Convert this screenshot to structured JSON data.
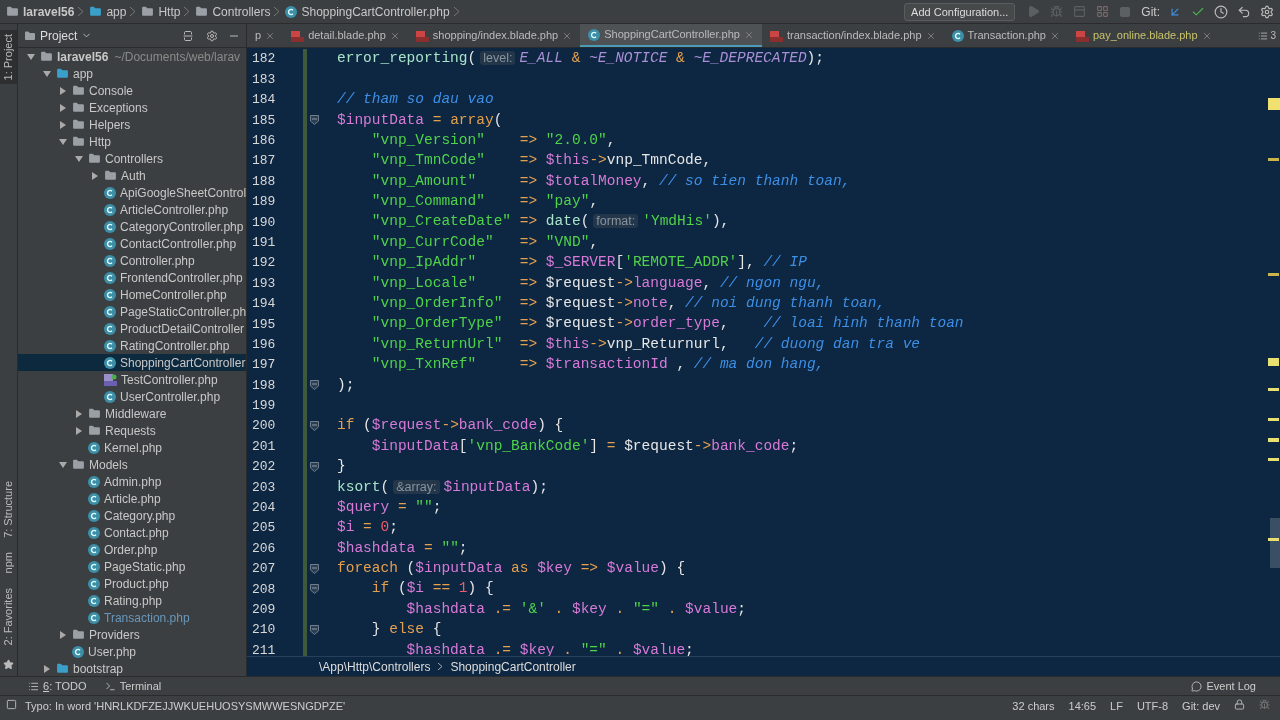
{
  "navbar": {
    "breadcrumb": [
      {
        "kind": "folder",
        "text": "laravel56"
      },
      {
        "kind": "folder",
        "text": "app"
      },
      {
        "kind": "folder",
        "text": "Http"
      },
      {
        "kind": "folder",
        "text": "Controllers"
      },
      {
        "kind": "class",
        "text": "ShoppingCartController.php"
      }
    ],
    "config_button": "Add Configuration...",
    "git_label": "Git:"
  },
  "tool_strip": {
    "top": "1: Project",
    "bottom": [
      "7: Structure",
      "npm",
      "2: Favorites"
    ]
  },
  "project": {
    "title": "Project",
    "tree": [
      {
        "name": "laravel56",
        "note": "~/Documents/web/larav",
        "kind": "folder",
        "expanded": true,
        "selected": false,
        "children": [
          {
            "name": "app",
            "kind": "folder",
            "expanded": true,
            "selected": false,
            "children": [
              {
                "name": "Console",
                "kind": "folder",
                "expanded": false,
                "selected": false
              },
              {
                "name": "Exceptions",
                "kind": "folder",
                "expanded": false,
                "selected": false
              },
              {
                "name": "Helpers",
                "kind": "folder",
                "expanded": false,
                "selected": false
              },
              {
                "name": "Http",
                "kind": "folder",
                "expanded": true,
                "selected": false,
                "children": [
                  {
                    "name": "Controllers",
                    "kind": "folder",
                    "expanded": true,
                    "selected": false,
                    "children": [
                      {
                        "name": "Auth",
                        "kind": "folder",
                        "expanded": false,
                        "selected": false
                      },
                      {
                        "name": "ApiGoogleSheetControl",
                        "kind": "class",
                        "changed": false,
                        "selected": false
                      },
                      {
                        "name": "ArticleController.php",
                        "kind": "class",
                        "changed": false,
                        "selected": false
                      },
                      {
                        "name": "CategoryController.php",
                        "kind": "class",
                        "changed": false,
                        "selected": false
                      },
                      {
                        "name": "ContactController.php",
                        "kind": "class",
                        "changed": false,
                        "selected": false
                      },
                      {
                        "name": "Controller.php",
                        "kind": "class",
                        "changed": false,
                        "selected": false
                      },
                      {
                        "name": "FrontendController.php",
                        "kind": "class",
                        "changed": false,
                        "selected": false
                      },
                      {
                        "name": "HomeController.php",
                        "kind": "class",
                        "changed": false,
                        "selected": false
                      },
                      {
                        "name": "PageStaticController.ph",
                        "kind": "class",
                        "changed": false,
                        "selected": false
                      },
                      {
                        "name": "ProductDetailController",
                        "kind": "class",
                        "changed": false,
                        "selected": false
                      },
                      {
                        "name": "RatingController.php",
                        "kind": "class",
                        "changed": false,
                        "selected": false
                      },
                      {
                        "name": "ShoppingCartController",
                        "kind": "class",
                        "changed": false,
                        "selected": true
                      },
                      {
                        "name": "TestController.php",
                        "kind": "php",
                        "changed": false,
                        "selected": false
                      },
                      {
                        "name": "UserController.php",
                        "kind": "class",
                        "changed": false,
                        "selected": false
                      }
                    ]
                  },
                  {
                    "name": "Middleware",
                    "kind": "folder",
                    "expanded": false,
                    "selected": false
                  },
                  {
                    "name": "Requests",
                    "kind": "folder",
                    "expanded": false,
                    "selected": false
                  },
                  {
                    "name": "Kernel.php",
                    "kind": "class",
                    "changed": false,
                    "selected": false
                  }
                ]
              },
              {
                "name": "Models",
                "kind": "folder",
                "expanded": true,
                "selected": false,
                "children": [
                  {
                    "name": "Admin.php",
                    "kind": "class",
                    "changed": false,
                    "selected": false
                  },
                  {
                    "name": "Article.php",
                    "kind": "class",
                    "changed": false,
                    "selected": false
                  },
                  {
                    "name": "Category.php",
                    "kind": "class",
                    "changed": false,
                    "selected": false
                  },
                  {
                    "name": "Contact.php",
                    "kind": "class",
                    "changed": false,
                    "selected": false
                  },
                  {
                    "name": "Order.php",
                    "kind": "class",
                    "changed": false,
                    "selected": false
                  },
                  {
                    "name": "PageStatic.php",
                    "kind": "class",
                    "changed": false,
                    "selected": false
                  },
                  {
                    "name": "Product.php",
                    "kind": "class",
                    "changed": false,
                    "selected": false
                  },
                  {
                    "name": "Rating.php",
                    "kind": "class",
                    "changed": false,
                    "selected": false
                  },
                  {
                    "name": "Transaction.php",
                    "kind": "class",
                    "changed": true,
                    "selected": false
                  }
                ]
              },
              {
                "name": "Providers",
                "kind": "folder",
                "expanded": false,
                "selected": false
              },
              {
                "name": "User.php",
                "kind": "class",
                "changed": false,
                "selected": false
              }
            ]
          },
          {
            "name": "bootstrap",
            "kind": "folder",
            "expanded": false,
            "selected": false
          }
        ]
      }
    ]
  },
  "tabs": [
    {
      "label": "p",
      "kind": "none",
      "selected": false,
      "modified": false
    },
    {
      "label": "detail.blade.php",
      "kind": "blade",
      "selected": false,
      "modified": false
    },
    {
      "label": "shopping/index.blade.php",
      "kind": "blade",
      "selected": false,
      "modified": false
    },
    {
      "label": "ShoppingCartController.php",
      "kind": "class",
      "selected": true,
      "modified": false
    },
    {
      "label": "transaction/index.blade.php",
      "kind": "blade",
      "selected": false,
      "modified": false
    },
    {
      "label": "Transaction.php",
      "kind": "class",
      "selected": false,
      "modified": false
    },
    {
      "label": "pay_online.blade.php",
      "kind": "blade",
      "selected": false,
      "modified": true
    }
  ],
  "tab_count": "3",
  "code": [
    {
      "number": "182",
      "fold": false,
      "tokens": [
        {
          "kind": "function",
          "text": "error_reporting"
        },
        {
          "kind": "plain",
          "text": "("
        },
        {
          "kind": "hint",
          "text": "level:"
        },
        {
          "kind": "constant",
          "text": "E_ALL"
        },
        {
          "kind": "operator",
          "text": " & "
        },
        {
          "kind": "constant",
          "text": "~E_NOTICE"
        },
        {
          "kind": "operator",
          "text": " & "
        },
        {
          "kind": "constant",
          "text": "~E_DEPRECATED"
        },
        {
          "kind": "plain",
          "text": ");"
        }
      ]
    },
    {
      "number": "183",
      "fold": false
    },
    {
      "number": "184",
      "fold": false,
      "tokens": [
        {
          "kind": "comment",
          "text": "// tham so dau vao"
        }
      ]
    },
    {
      "number": "185",
      "fold": true,
      "tokens": [
        {
          "kind": "variable",
          "text": "$inputData"
        },
        {
          "kind": "operator",
          "text": " = "
        },
        {
          "kind": "keyword",
          "text": "array"
        },
        {
          "kind": "plain",
          "text": "("
        }
      ]
    },
    {
      "number": "186",
      "fold": false,
      "tokens": [
        {
          "kind": "string",
          "text": "    \"vnp_Version\""
        },
        {
          "kind": "operator",
          "text": "    => "
        },
        {
          "kind": "string",
          "text": "\"2.0.0\""
        },
        {
          "kind": "plain",
          "text": ","
        }
      ]
    },
    {
      "number": "187",
      "fold": false,
      "tokens": [
        {
          "kind": "string",
          "text": "    \"vnp_TmnCode\""
        },
        {
          "kind": "operator",
          "text": "    => "
        },
        {
          "kind": "variable",
          "text": "$this"
        },
        {
          "kind": "operator",
          "text": "->"
        },
        {
          "kind": "plain",
          "text": "vnp_TmnCode,"
        }
      ]
    },
    {
      "number": "188",
      "fold": false,
      "tokens": [
        {
          "kind": "string",
          "text": "    \"vnp_Amount\""
        },
        {
          "kind": "operator",
          "text": "     => "
        },
        {
          "kind": "variable",
          "text": "$totalMoney"
        },
        {
          "kind": "plain",
          "text": ", "
        },
        {
          "kind": "comment",
          "text": "// so tien thanh toan,"
        }
      ]
    },
    {
      "number": "189",
      "fold": false,
      "tokens": [
        {
          "kind": "string",
          "text": "    \"vnp_Command\""
        },
        {
          "kind": "operator",
          "text": "    => "
        },
        {
          "kind": "string",
          "text": "\"pay\""
        },
        {
          "kind": "plain",
          "text": ","
        }
      ]
    },
    {
      "number": "190",
      "fold": false,
      "tokens": [
        {
          "kind": "string",
          "text": "    \"vnp_CreateDate\""
        },
        {
          "kind": "operator",
          "text": " => "
        },
        {
          "kind": "function",
          "text": "date"
        },
        {
          "kind": "plain",
          "text": "("
        },
        {
          "kind": "hint",
          "text": "format:"
        },
        {
          "kind": "string",
          "text": "'YmdHis'"
        },
        {
          "kind": "plain",
          "text": "),"
        }
      ]
    },
    {
      "number": "191",
      "fold": false,
      "tokens": [
        {
          "kind": "string",
          "text": "    \"vnp_CurrCode\""
        },
        {
          "kind": "operator",
          "text": "   => "
        },
        {
          "kind": "string",
          "text": "\"VND\""
        },
        {
          "kind": "plain",
          "text": ","
        }
      ]
    },
    {
      "number": "192",
      "fold": false,
      "tokens": [
        {
          "kind": "string",
          "text": "    \"vnp_IpAddr\""
        },
        {
          "kind": "operator",
          "text": "     => "
        },
        {
          "kind": "variable",
          "text": "$_SERVER"
        },
        {
          "kind": "plain",
          "text": "["
        },
        {
          "kind": "string",
          "text": "'REMOTE_ADDR'"
        },
        {
          "kind": "plain",
          "text": "], "
        },
        {
          "kind": "comment",
          "text": "// IP"
        }
      ]
    },
    {
      "number": "193",
      "fold": false,
      "tokens": [
        {
          "kind": "string",
          "text": "    \"vnp_Locale\""
        },
        {
          "kind": "operator",
          "text": "     => "
        },
        {
          "kind": "plain",
          "text": "$request"
        },
        {
          "kind": "operator",
          "text": "->"
        },
        {
          "kind": "property",
          "text": "language"
        },
        {
          "kind": "plain",
          "text": ", "
        },
        {
          "kind": "comment",
          "text": "// ngon ngu,"
        }
      ]
    },
    {
      "number": "194",
      "fold": false,
      "tokens": [
        {
          "kind": "string",
          "text": "    \"vnp_OrderInfo\""
        },
        {
          "kind": "operator",
          "text": "  => "
        },
        {
          "kind": "plain",
          "text": "$request"
        },
        {
          "kind": "operator",
          "text": "->"
        },
        {
          "kind": "property",
          "text": "note"
        },
        {
          "kind": "plain",
          "text": ", "
        },
        {
          "kind": "comment",
          "text": "// noi dung thanh toan,"
        }
      ]
    },
    {
      "number": "195",
      "fold": false,
      "tokens": [
        {
          "kind": "string",
          "text": "    \"vnp_OrderType\""
        },
        {
          "kind": "operator",
          "text": "  => "
        },
        {
          "kind": "plain",
          "text": "$request"
        },
        {
          "kind": "operator",
          "text": "->"
        },
        {
          "kind": "property",
          "text": "order_type"
        },
        {
          "kind": "plain",
          "text": ",    "
        },
        {
          "kind": "comment",
          "text": "// loai hinh thanh toan"
        }
      ]
    },
    {
      "number": "196",
      "fold": false,
      "tokens": [
        {
          "kind": "string",
          "text": "    \"vnp_ReturnUrl\""
        },
        {
          "kind": "operator",
          "text": "  => "
        },
        {
          "kind": "variable",
          "text": "$this"
        },
        {
          "kind": "operator",
          "text": "->"
        },
        {
          "kind": "plain",
          "text": "vnp_Returnurl,   "
        },
        {
          "kind": "comment",
          "text": "// duong dan tra ve"
        }
      ]
    },
    {
      "number": "197",
      "fold": false,
      "tokens": [
        {
          "kind": "string",
          "text": "    \"vnp_TxnRef\""
        },
        {
          "kind": "operator",
          "text": "     => "
        },
        {
          "kind": "variable",
          "text": "$transactionId"
        },
        {
          "kind": "plain",
          "text": " , "
        },
        {
          "kind": "comment",
          "text": "// ma don hang,"
        }
      ]
    },
    {
      "number": "198",
      "fold": true,
      "tokens": [
        {
          "kind": "plain",
          "text": ");"
        }
      ]
    },
    {
      "number": "199",
      "fold": false
    },
    {
      "number": "200",
      "fold": true,
      "tokens": [
        {
          "kind": "keyword",
          "text": "if"
        },
        {
          "kind": "plain",
          "text": " ("
        },
        {
          "kind": "variable",
          "text": "$request"
        },
        {
          "kind": "operator",
          "text": "->"
        },
        {
          "kind": "property",
          "text": "bank_code"
        },
        {
          "kind": "plain",
          "text": ") {"
        }
      ]
    },
    {
      "number": "201",
      "fold": false,
      "tokens": [
        {
          "kind": "variable",
          "text": "    $inputData"
        },
        {
          "kind": "plain",
          "text": "["
        },
        {
          "kind": "string",
          "text": "'vnp_BankCode'"
        },
        {
          "kind": "plain",
          "text": "] "
        },
        {
          "kind": "operator",
          "text": "= "
        },
        {
          "kind": "plain",
          "text": "$request"
        },
        {
          "kind": "operator",
          "text": "->"
        },
        {
          "kind": "property",
          "text": "bank_code"
        },
        {
          "kind": "plain",
          "text": ";"
        }
      ]
    },
    {
      "number": "202",
      "fold": true,
      "tokens": [
        {
          "kind": "plain",
          "text": "}"
        }
      ]
    },
    {
      "number": "203",
      "fold": false,
      "tokens": [
        {
          "kind": "function",
          "text": "ksort"
        },
        {
          "kind": "plain",
          "text": "("
        },
        {
          "kind": "hint",
          "text": "&array:"
        },
        {
          "kind": "variable",
          "text": "$inputData"
        },
        {
          "kind": "plain",
          "text": ");"
        }
      ]
    },
    {
      "number": "204",
      "fold": false,
      "tokens": [
        {
          "kind": "variable",
          "text": "$query"
        },
        {
          "kind": "operator",
          "text": " = "
        },
        {
          "kind": "string",
          "text": "\"\""
        },
        {
          "kind": "plain",
          "text": ";"
        }
      ]
    },
    {
      "number": "205",
      "fold": false,
      "tokens": [
        {
          "kind": "variable",
          "text": "$i"
        },
        {
          "kind": "operator",
          "text": " = "
        },
        {
          "kind": "number",
          "text": "0"
        },
        {
          "kind": "plain",
          "text": ";"
        }
      ]
    },
    {
      "number": "206",
      "fold": false,
      "tokens": [
        {
          "kind": "variable",
          "text": "$hashdata"
        },
        {
          "kind": "operator",
          "text": " = "
        },
        {
          "kind": "string",
          "text": "\"\""
        },
        {
          "kind": "plain",
          "text": ";"
        }
      ]
    },
    {
      "number": "207",
      "fold": true,
      "tokens": [
        {
          "kind": "keyword",
          "text": "foreach"
        },
        {
          "kind": "plain",
          "text": " ("
        },
        {
          "kind": "variable",
          "text": "$inputData"
        },
        {
          "kind": "keyword",
          "text": " as "
        },
        {
          "kind": "variable",
          "text": "$key"
        },
        {
          "kind": "operator",
          "text": " => "
        },
        {
          "kind": "variable",
          "text": "$value"
        },
        {
          "kind": "plain",
          "text": ") {"
        }
      ]
    },
    {
      "number": "208",
      "fold": true,
      "tokens": [
        {
          "kind": "keyword",
          "text": "    if"
        },
        {
          "kind": "plain",
          "text": " ("
        },
        {
          "kind": "variable",
          "text": "$i"
        },
        {
          "kind": "operator",
          "text": " == "
        },
        {
          "kind": "number",
          "text": "1"
        },
        {
          "kind": "plain",
          "text": ") {"
        }
      ]
    },
    {
      "number": "209",
      "fold": false,
      "tokens": [
        {
          "kind": "variable",
          "text": "        $hashdata"
        },
        {
          "kind": "operator",
          "text": " .= "
        },
        {
          "kind": "string",
          "text": "'&'"
        },
        {
          "kind": "operator",
          "text": " . "
        },
        {
          "kind": "variable",
          "text": "$key"
        },
        {
          "kind": "operator",
          "text": " . "
        },
        {
          "kind": "string",
          "text": "\"=\""
        },
        {
          "kind": "operator",
          "text": " . "
        },
        {
          "kind": "variable",
          "text": "$value"
        },
        {
          "kind": "plain",
          "text": ";"
        }
      ]
    },
    {
      "number": "210",
      "fold": true,
      "tokens": [
        {
          "kind": "plain",
          "text": "    } "
        },
        {
          "kind": "keyword",
          "text": "else"
        },
        {
          "kind": "plain",
          "text": " {"
        }
      ]
    },
    {
      "number": "211",
      "fold": false,
      "tokens": [
        {
          "kind": "variable",
          "text": "        $hashdata"
        },
        {
          "kind": "operator",
          "text": " .= "
        },
        {
          "kind": "variable",
          "text": "$key"
        },
        {
          "kind": "operator",
          "text": " . "
        },
        {
          "kind": "string",
          "text": "\"=\""
        },
        {
          "kind": "operator",
          "text": " . "
        },
        {
          "kind": "variable",
          "text": "$value"
        },
        {
          "kind": "plain",
          "text": ";"
        }
      ]
    }
  ],
  "editor_breadcrumb": [
    "\\App\\Http\\Controllers",
    "ShoppingCartController"
  ],
  "tool_windows": {
    "todo": {
      "key": "6",
      "label": ": TODO"
    },
    "terminal": "Terminal",
    "event_log": "Event Log"
  },
  "status_bar": {
    "message": "Typo: In word 'HNRLKDFZEJJWKUEHUOSYSMWWESNGDPZE'",
    "chars": "32 chars",
    "position": "14:65",
    "line_ending": "LF",
    "encoding": "UTF-8",
    "branch": "Git: dev"
  }
}
